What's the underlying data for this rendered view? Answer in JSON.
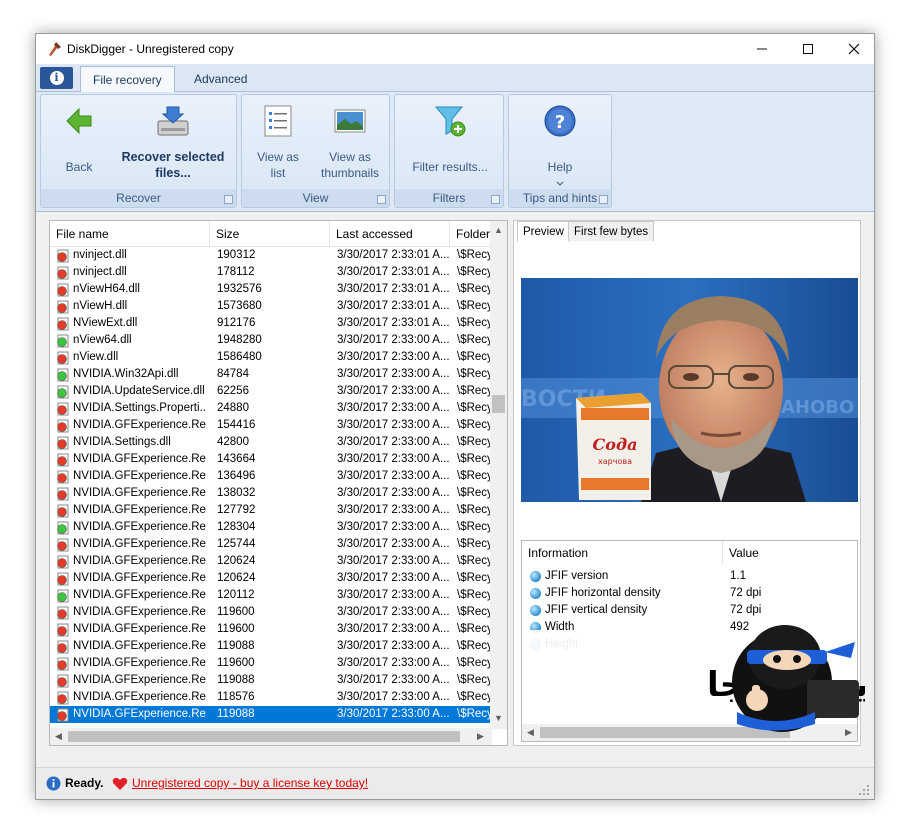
{
  "window": {
    "title": "DiskDigger - Unregistered copy"
  },
  "tabs": {
    "file_recovery": "File recovery",
    "advanced": "Advanced"
  },
  "ribbon": {
    "back": "Back",
    "recover_selected": "Recover selected files...",
    "recover_group": "Recover",
    "view_list": "View as list",
    "view_thumbnails": "View as thumbnails",
    "view_group": "View",
    "filter_results": "Filter results...",
    "filters_group": "Filters",
    "help": "Help",
    "tips_group": "Tips and hints"
  },
  "file_list": {
    "columns": [
      "File name",
      "Size",
      "Last accessed",
      "Folder"
    ],
    "rows": [
      {
        "name": "nvinject.dll",
        "size": "190312",
        "date": "3/30/2017 2:33:01 A...",
        "folder": "\\$Recy",
        "status": "red"
      },
      {
        "name": "nvinject.dll",
        "size": "178112",
        "date": "3/30/2017 2:33:01 A...",
        "folder": "\\$Recy",
        "status": "red"
      },
      {
        "name": "nViewH64.dll",
        "size": "1932576",
        "date": "3/30/2017 2:33:01 A...",
        "folder": "\\$Recy",
        "status": "red"
      },
      {
        "name": "nViewH.dll",
        "size": "1573680",
        "date": "3/30/2017 2:33:01 A...",
        "folder": "\\$Recy",
        "status": "red"
      },
      {
        "name": "NViewExt.dll",
        "size": "912176",
        "date": "3/30/2017 2:33:01 A...",
        "folder": "\\$Recy",
        "status": "red"
      },
      {
        "name": "nView64.dll",
        "size": "1948280",
        "date": "3/30/2017 2:33:00 A...",
        "folder": "\\$Recy",
        "status": "green"
      },
      {
        "name": "nView.dll",
        "size": "1586480",
        "date": "3/30/2017 2:33:00 A...",
        "folder": "\\$Recy",
        "status": "red"
      },
      {
        "name": "NVIDIA.Win32Api.dll",
        "size": "84784",
        "date": "3/30/2017 2:33:00 A...",
        "folder": "\\$Recy",
        "status": "green"
      },
      {
        "name": "NVIDIA.UpdateService.dll",
        "size": "62256",
        "date": "3/30/2017 2:33:00 A...",
        "folder": "\\$Recy",
        "status": "green"
      },
      {
        "name": "NVIDIA.Settings.Properti...",
        "size": "24880",
        "date": "3/30/2017 2:33:00 A...",
        "folder": "\\$Recy",
        "status": "red"
      },
      {
        "name": "NVIDIA.GFExperience.Re...",
        "size": "154416",
        "date": "3/30/2017 2:33:00 A...",
        "folder": "\\$Recy",
        "status": "red"
      },
      {
        "name": "NVIDIA.Settings.dll",
        "size": "42800",
        "date": "3/30/2017 2:33:00 A...",
        "folder": "\\$Recy",
        "status": "red"
      },
      {
        "name": "NVIDIA.GFExperience.Re...",
        "size": "143664",
        "date": "3/30/2017 2:33:00 A...",
        "folder": "\\$Recy",
        "status": "red"
      },
      {
        "name": "NVIDIA.GFExperience.Re...",
        "size": "136496",
        "date": "3/30/2017 2:33:00 A...",
        "folder": "\\$Recy",
        "status": "red"
      },
      {
        "name": "NVIDIA.GFExperience.Re...",
        "size": "138032",
        "date": "3/30/2017 2:33:00 A...",
        "folder": "\\$Recy",
        "status": "red"
      },
      {
        "name": "NVIDIA.GFExperience.Re...",
        "size": "127792",
        "date": "3/30/2017 2:33:00 A...",
        "folder": "\\$Recy",
        "status": "red"
      },
      {
        "name": "NVIDIA.GFExperience.Re...",
        "size": "128304",
        "date": "3/30/2017 2:33:00 A...",
        "folder": "\\$Recy",
        "status": "green"
      },
      {
        "name": "NVIDIA.GFExperience.Re...",
        "size": "125744",
        "date": "3/30/2017 2:33:00 A...",
        "folder": "\\$Recy",
        "status": "red"
      },
      {
        "name": "NVIDIA.GFExperience.Re...",
        "size": "120624",
        "date": "3/30/2017 2:33:00 A...",
        "folder": "\\$Recy",
        "status": "red"
      },
      {
        "name": "NVIDIA.GFExperience.Re...",
        "size": "120624",
        "date": "3/30/2017 2:33:00 A...",
        "folder": "\\$Recy",
        "status": "red"
      },
      {
        "name": "NVIDIA.GFExperience.Re...",
        "size": "120112",
        "date": "3/30/2017 2:33:00 A...",
        "folder": "\\$Recy",
        "status": "green"
      },
      {
        "name": "NVIDIA.GFExperience.Re...",
        "size": "119600",
        "date": "3/30/2017 2:33:00 A...",
        "folder": "\\$Recy",
        "status": "red"
      },
      {
        "name": "NVIDIA.GFExperience.Re...",
        "size": "119600",
        "date": "3/30/2017 2:33:00 A...",
        "folder": "\\$Recy",
        "status": "red"
      },
      {
        "name": "NVIDIA.GFExperience.Re...",
        "size": "119088",
        "date": "3/30/2017 2:33:00 A...",
        "folder": "\\$Recy",
        "status": "red"
      },
      {
        "name": "NVIDIA.GFExperience.Re...",
        "size": "119600",
        "date": "3/30/2017 2:33:00 A...",
        "folder": "\\$Recy",
        "status": "red"
      },
      {
        "name": "NVIDIA.GFExperience.Re...",
        "size": "119088",
        "date": "3/30/2017 2:33:00 A...",
        "folder": "\\$Recy",
        "status": "red"
      },
      {
        "name": "NVIDIA.GFExperience.Re...",
        "size": "118576",
        "date": "3/30/2017 2:33:00 A...",
        "folder": "\\$Recy",
        "status": "red"
      },
      {
        "name": "NVIDIA.GFExperience.Re...",
        "size": "119088",
        "date": "3/30/2017 2:33:00 A...",
        "folder": "\\$Recy",
        "status": "red",
        "selected": true
      }
    ]
  },
  "preview": {
    "tabs": [
      "Preview",
      "First few bytes"
    ],
    "package_label": "Сода",
    "package_sublabel": "харчова",
    "info_columns": [
      "Information",
      "Value"
    ],
    "info": [
      {
        "key": "JFIF version",
        "value": "1.1"
      },
      {
        "key": "JFIF horizontal density",
        "value": "72 dpi"
      },
      {
        "key": "JFIF vertical density",
        "value": "72 dpi"
      },
      {
        "key": "Width",
        "value": "492"
      },
      {
        "key": "Height",
        "value": ""
      }
    ]
  },
  "status": {
    "ready": "Ready.",
    "link": "Unregistered copy - buy a license key today!"
  },
  "watermark": {
    "text": "ايجي نينجا"
  },
  "colors": {
    "selection": "#0078d7",
    "ribbon_text": "#3b5a82",
    "link": "#e00000"
  }
}
